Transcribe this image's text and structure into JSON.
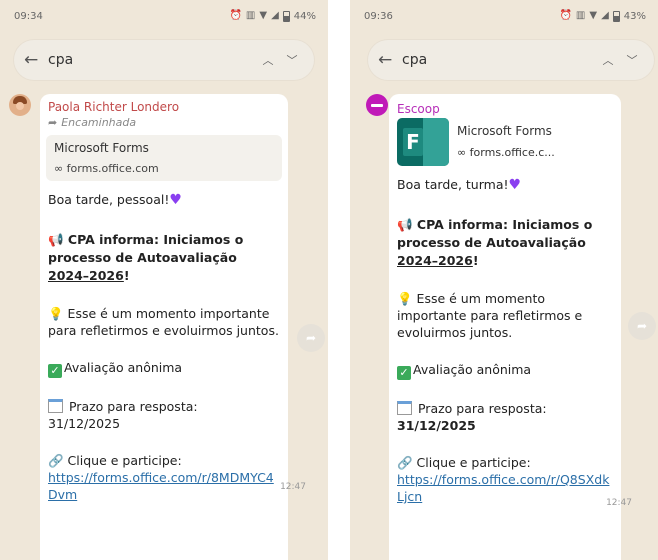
{
  "left": {
    "statusbar": {
      "time": "09:34",
      "battery": "44%"
    },
    "search": {
      "query": "cpa"
    },
    "message": {
      "sender": "Paola Richter Londero",
      "forwarded": "Encaminhada",
      "link_preview": {
        "title": "Microsoft Forms",
        "url": "forms.office.com"
      },
      "greeting": "Boa tarde, pessoal!",
      "headline_prefix": "CPA informa: Iniciamos o processo de Autoavaliação ",
      "headline_year": "2024–2026",
      "headline_suffix": "!",
      "moment": "Esse é um momento importante para refletirmos e evoluirmos juntos.",
      "anon": "Avaliação anônima",
      "deadline_label": "Prazo para resposta:",
      "deadline_date": "31/12/2025",
      "cta": "Clique e participe:",
      "link": "https://forms.office.com/r/8MDMYC4Dvm",
      "time": "12:47"
    }
  },
  "right": {
    "statusbar": {
      "time": "09:36",
      "battery": "43%"
    },
    "search": {
      "query": "cpa"
    },
    "message": {
      "sender": "Escoop",
      "link_preview": {
        "title": "Microsoft Forms",
        "url": "forms.office.c..."
      },
      "greeting": "Boa tarde, turma!",
      "headline_prefix": "CPA informa: Iniciamos o processo de Autoavaliação ",
      "headline_year": "2024–2026",
      "headline_suffix": "!",
      "moment": "Esse é um momento importante para refletirmos e evoluirmos juntos.",
      "anon": "Avaliação anônima",
      "deadline_label": "Prazo para resposta:",
      "deadline_date": "31/12/2025",
      "cta": "Clique e participe:",
      "link": "https://forms.office.com/r/Q8SXdkLjcn",
      "time": "12:47"
    }
  },
  "icons": {
    "back": "arrow-left",
    "search_up": "chevron-up",
    "search_down": "chevron-down",
    "share": "share-arrow",
    "forms_logo": "microsoft-forms"
  },
  "colors": {
    "chat_background": "#efe7d9",
    "bubble": "#ffffff",
    "left_sender": "#c14a4a",
    "right_sender": "#b62db8",
    "link": "#2b6fa8"
  }
}
